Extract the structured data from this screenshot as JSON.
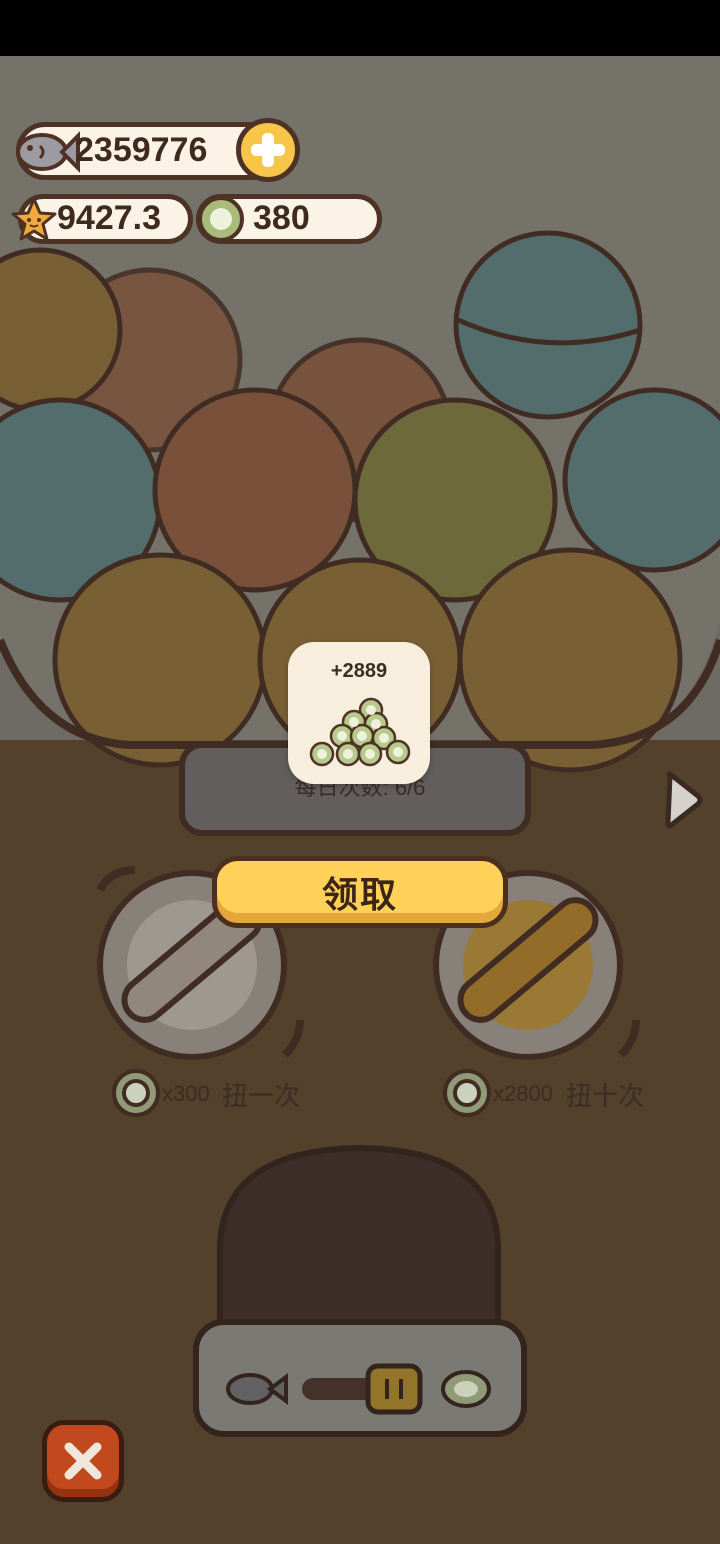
{
  "currencies": {
    "fish": {
      "value": "2359776",
      "icon": "fish-icon"
    },
    "star": {
      "value": "9427.3",
      "icon": "star-icon"
    },
    "coin": {
      "value": "380",
      "icon": "coin-icon"
    }
  },
  "machine": {
    "daily_count_text": "每日次数: 6/6"
  },
  "spins": {
    "single": {
      "multiplier": "x300",
      "label": "扭一次"
    },
    "ten": {
      "multiplier": "x2800",
      "label": "扭十次"
    }
  },
  "reward_popup": {
    "amount": "+2889",
    "icon": "coin-pile-icon",
    "claim_label": "领取"
  },
  "colors": {
    "accent_yellow": "#ffd159",
    "close_red": "#c2491e",
    "outline_brown": "#4e3226"
  }
}
